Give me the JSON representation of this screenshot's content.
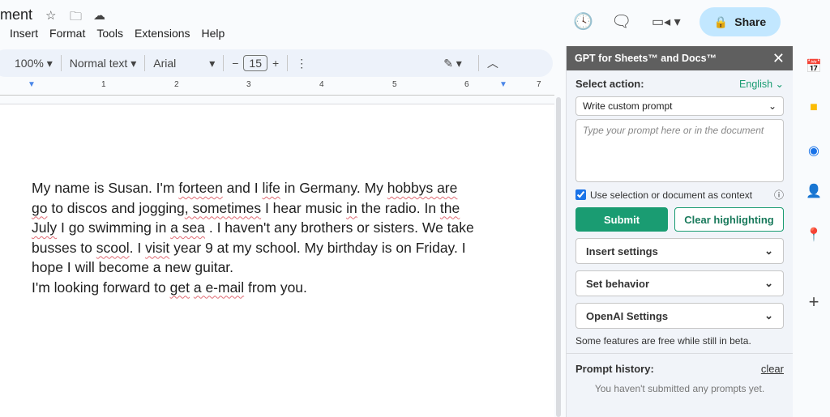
{
  "doc_title": "ment",
  "menu": [
    "Insert",
    "Format",
    "Tools",
    "Extensions",
    "Help"
  ],
  "toolbar": {
    "zoom": "100%",
    "style": "Normal text",
    "font": "Arial",
    "font_size": "15"
  },
  "ruler": [
    "1",
    "2",
    "3",
    "4",
    "5",
    "6",
    "7"
  ],
  "share": "Share",
  "document": [
    [
      {
        "t": "My name is Susan. I'm "
      },
      {
        "t": "forteen",
        "e": 1
      },
      {
        "t": " and I "
      },
      {
        "t": "life",
        "e": 1
      },
      {
        "t": " in Germany. My "
      },
      {
        "t": "hobbys are",
        "e": 1
      }
    ],
    [
      {
        "t": "go",
        "e": 1
      },
      {
        "t": " to discos and jogging"
      },
      {
        "t": ", sometimes",
        "e": 1
      },
      {
        "t": " I hear music "
      },
      {
        "t": "in",
        "e": 1
      },
      {
        "t": " the radio. In "
      },
      {
        "t": "the",
        "e": 1
      }
    ],
    [
      {
        "t": "July",
        "e": 1
      },
      {
        "t": " I go swimming in "
      },
      {
        "t": "a sea",
        "e": 1
      },
      {
        "t": " . I haven't any brothers or sisters. We take"
      }
    ],
    [
      {
        "t": "busses to "
      },
      {
        "t": "scool",
        "e": 1
      },
      {
        "t": ". I "
      },
      {
        "t": "visit",
        "e": 1
      },
      {
        "t": " year 9 at my school. My birthday is on Friday. I"
      }
    ],
    [
      {
        "t": "hope I will become a new guitar."
      }
    ],
    [
      {
        "t": "I'm looking forward to "
      },
      {
        "t": "get",
        "e": 1
      },
      {
        "t": " "
      },
      {
        "t": "a e-mail",
        "e": 1
      },
      {
        "t": " from you."
      }
    ]
  ],
  "panel": {
    "title": "GPT for Sheets™ and Docs™",
    "select_action": "Select action:",
    "language": "English",
    "action": "Write custom prompt",
    "prompt_placeholder": "Type your prompt here or in the document",
    "context_label": "Use selection or document as context",
    "context_checked": true,
    "submit": "Submit",
    "clear_highlighting": "Clear highlighting",
    "sections": [
      "Insert settings",
      "Set behavior",
      "OpenAI Settings"
    ],
    "beta_note": "Some features are free while still in beta.",
    "history_label": "Prompt history:",
    "history_clear": "clear",
    "history_empty": "You haven't submitted any prompts yet."
  },
  "colors": {
    "accent": "#1a9c72",
    "share_bg": "#c2e7ff",
    "panel_header": "#5f5f5f"
  }
}
